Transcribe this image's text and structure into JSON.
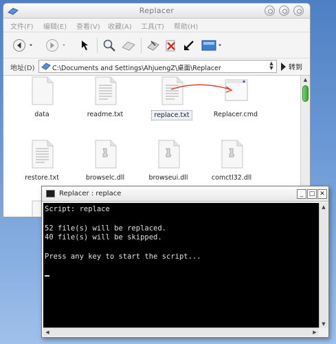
{
  "explorer": {
    "title": "Replacer",
    "menu": [
      "文件(F)",
      "编辑(E)",
      "查看(V)",
      "收藏(A)",
      "工具(T)",
      "帮助(H)"
    ],
    "address_label": "地址(D)",
    "address_value": "C:\\Documents and Settings\\AhjuengZ\\桌面\\Replacer",
    "go_label": "转到",
    "files": [
      {
        "name": "data",
        "icon": "generic-file-icon"
      },
      {
        "name": "readme.txt",
        "icon": "text-file-icon"
      },
      {
        "name": "replace.txt",
        "icon": "text-file-icon",
        "selected": true
      },
      {
        "name": "Replacer.cmd",
        "icon": "command-file-icon"
      },
      {
        "name": "restore.txt",
        "icon": "text-file-icon"
      },
      {
        "name": "browselc.dll",
        "icon": "dll-file-icon"
      },
      {
        "name": "browseui.dll",
        "icon": "dll-file-icon"
      },
      {
        "name": "comctl32.dll",
        "icon": "dll-file-icon"
      }
    ],
    "drag_arrow_color": "#e23b2a"
  },
  "console": {
    "title": "Replacer : replace",
    "lines": [
      "Script: replace",
      "",
      "52 file(s) will be replaced.",
      "40 file(s) will be skipped.",
      "",
      "Press any key to start the script..."
    ]
  }
}
